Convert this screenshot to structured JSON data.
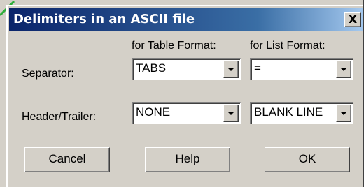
{
  "dialog": {
    "title": "Delimiters in an ASCII file",
    "close_label": "X"
  },
  "columns": {
    "table_format": "for Table Format:",
    "list_format": "for List Format:"
  },
  "rows": {
    "separator": {
      "label": "Separator:",
      "table_value": "TABS",
      "list_value": "="
    },
    "header_trailer": {
      "label": "Header/Trailer:",
      "table_value": "NONE",
      "list_value": "BLANK LINE"
    }
  },
  "buttons": {
    "cancel": "Cancel",
    "help": "Help",
    "ok": "OK"
  },
  "colors": {
    "title_bar_start": "#0a246a",
    "title_bar_end": "#a6caf0",
    "face": "#d4d0c8",
    "pointer_line": "#2fae3a"
  },
  "icons": {
    "close": "close-icon",
    "dropdown": "chevron-down-icon"
  }
}
